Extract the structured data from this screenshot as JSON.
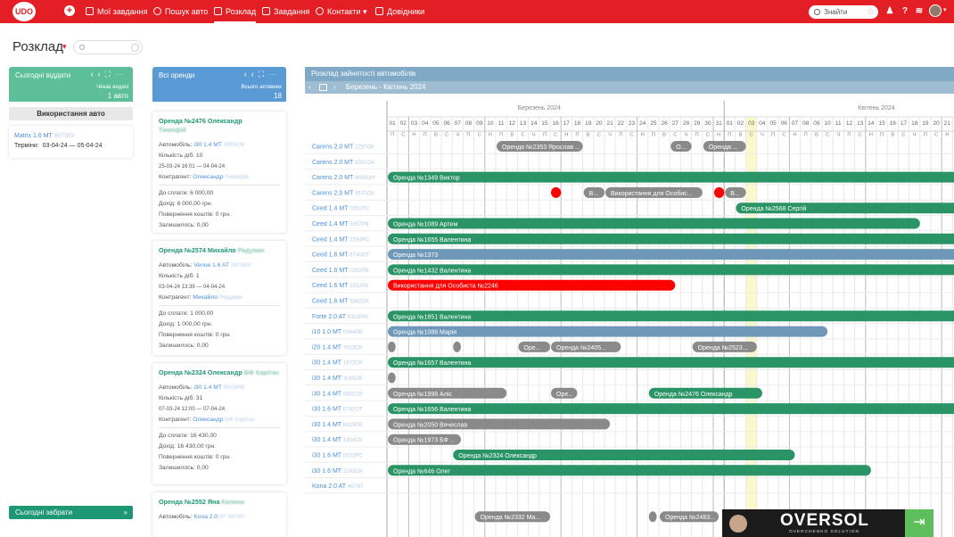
{
  "nav": {
    "logo_text": "UDO",
    "items": [
      "Мої завдання",
      "Пошук авто",
      "Розклад",
      "Завдання",
      "Контакти",
      "Довідники"
    ],
    "search_placeholder": "Знайти"
  },
  "page": {
    "title": "Розклад"
  },
  "today_give": {
    "title": "Сьогодні віддати",
    "subtitle": "Чекає видачі",
    "count": "1 авто"
  },
  "usage_button": "Використання авто",
  "usage_card": {
    "car": "Matrix 1.6 MT",
    "plate": "8079ОІ",
    "label": "Терміни:",
    "dates": "03-04-24 — 05-04-24"
  },
  "today_pick": {
    "title": "Сьогодні забрати"
  },
  "all_rentals": {
    "title": "Всі оренди",
    "subtitle": "Всього активних",
    "count": "18"
  },
  "rentals": [
    {
      "title": "Оренда №2476 Олександр",
      "surname": "Тимофій",
      "car": "i30 1.4 MT",
      "plate": "3065ОК",
      "days": "10",
      "period": "25-03-24 16:01 — 04-04-24",
      "counterparty": "Олександр",
      "counterparty_last": "Тимофій",
      "to_pay": "6 000,00",
      "income": "6 000,00 грн.",
      "refund": "0 грн.",
      "left": "0,00"
    },
    {
      "title": "Оренда №2574 Михайло",
      "surname": "Радуван",
      "car": "Venue 1.6 AT",
      "plate": "2678КК",
      "days": "1",
      "period": "03-04-24 13:39 — 04-04-24",
      "counterparty": "Михайло",
      "counterparty_last": "Радуван",
      "to_pay": "1 000,00",
      "income": "1 000,00 грн.",
      "refund": "0 грн.",
      "left": "0,00"
    },
    {
      "title": "Оренда №2324 Олександр",
      "surname": "БФ Карітас",
      "car": "i30 1.4 MT",
      "plate": "8919РВ",
      "days": "31",
      "period": "07-03-24 12:00 — 07-04-24",
      "counterparty": "Олександр",
      "counterparty_last": "БФ Карітас",
      "to_pay": "16 430,00",
      "income": "16 430,00 грн.",
      "refund": "0 грн.",
      "left": "0,00"
    },
    {
      "title": "Оренда №2552 Яна",
      "surname": "Калина",
      "car": "Kona 2.0",
      "plate": "07 4674П"
    }
  ],
  "rental_labels": {
    "car": "Автомобіль:",
    "days": "Кількість діб:",
    "counterparty": "Контрагент:",
    "to_pay": "До сплати:",
    "income": "Дохід:",
    "refund": "Повернення коштів:",
    "left": "Залишилось:"
  },
  "schedule": {
    "title": "Розклад зайнятості автомобілів",
    "range": "Березень - Квітень 2024",
    "months": [
      "Березень 2024",
      "Квітень 2024"
    ],
    "first_day": 1,
    "first_weekday_index": 4,
    "weekday_letters": [
      "П",
      "В",
      "С",
      "Ч",
      "П",
      "С",
      "Н"
    ],
    "today_day": 34,
    "cars": [
      {
        "name": "Carens 2.0 MT",
        "plate": "2257ОК"
      },
      {
        "name": "Carens 2.0 MT",
        "plate": "8331ОХ"
      },
      {
        "name": "Carens 2.0 MT",
        "plate": "9606ОН"
      },
      {
        "name": "Carens 2.0 MT",
        "plate": "9570ОХ"
      },
      {
        "name": "Ceed 1.4 MT",
        "plate": "0551РС"
      },
      {
        "name": "Ceed 1.4 MT",
        "plate": "5957РВ"
      },
      {
        "name": "Ceed 1.4 MT",
        "plate": "2334РС"
      },
      {
        "name": "Ceed 1.6 MT",
        "plate": "8740ОТ"
      },
      {
        "name": "Ceed 1.6 MT",
        "plate": "0282РВ"
      },
      {
        "name": "Ceed 1.6 MT",
        "plate": "1552РК"
      },
      {
        "name": "Ceed 1.6 MT",
        "plate": "5882ОХ"
      },
      {
        "name": "Forte 2.0 AT",
        "plate": "6363РМ"
      },
      {
        "name": "i10 1.0 MT",
        "plate": "0964РВ"
      },
      {
        "name": "i20 1.4 MT",
        "plate": "7623ОХ"
      },
      {
        "name": "i30 1.4 MT",
        "plate": "1672ОХ"
      },
      {
        "name": "i30 1.4 MT",
        "plate": "3065ОК"
      },
      {
        "name": "i30 1.4 MT",
        "plate": "5881ОХ"
      },
      {
        "name": "i30 1.6 MT",
        "plate": "8782ОТ"
      },
      {
        "name": "i30 1.4 MT",
        "plate": "8919РВ"
      },
      {
        "name": "i30 1.4 MT",
        "plate": "1904ОХ"
      },
      {
        "name": "i30 1.6 MT",
        "plate": "0552РС"
      },
      {
        "name": "i30 1.6 MT",
        "plate": "2243ОХ"
      },
      {
        "name": "Kona 2.0 AT",
        "plate": "4674П"
      }
    ],
    "bookings": [
      {
        "row": 0,
        "start": 11,
        "end": 19,
        "label": "Оренда №2353 Ярослав ...",
        "color": "#8a8a8a"
      },
      {
        "row": 0,
        "start": 27,
        "end": 29,
        "label": "О...",
        "color": "#8a8a8a"
      },
      {
        "row": 0,
        "start": 30,
        "end": 34,
        "label": "Оренда ...",
        "color": "#8a8a8a"
      },
      {
        "row": 2,
        "start": 1,
        "end": 54,
        "label": "Оренда №1349 Виктор",
        "color": "#2a9467"
      },
      {
        "row": 3,
        "start": 16,
        "end": 17,
        "label": "",
        "color": "#ff0000"
      },
      {
        "row": 3,
        "start": 19,
        "end": 21,
        "label": "В...",
        "color": "#8a8a8a"
      },
      {
        "row": 3,
        "start": 21,
        "end": 30,
        "label": "Використання для Особис...",
        "color": "#8a8a8a"
      },
      {
        "row": 3,
        "start": 31,
        "end": 32,
        "label": "",
        "color": "#ff0000"
      },
      {
        "row": 3,
        "start": 32,
        "end": 34,
        "label": "В...",
        "color": "#8a8a8a"
      },
      {
        "row": 4,
        "start": 33,
        "end": 54,
        "label": "Оренда №2568 Сергій",
        "color": "#2a9467"
      },
      {
        "row": 5,
        "start": 1,
        "end": 50,
        "label": "Оренда №1089 Артем",
        "color": "#2a9467"
      },
      {
        "row": 6,
        "start": 1,
        "end": 54,
        "label": "Оренда №1655 Валентина",
        "color": "#2a9467"
      },
      {
        "row": 7,
        "start": 1,
        "end": 54,
        "label": "Оренда №1373",
        "color": "#6f98b8"
      },
      {
        "row": 8,
        "start": 1,
        "end": 54,
        "label": "Оренда №1432 Валентина",
        "color": "#2a9467"
      },
      {
        "row": 9,
        "start": 1,
        "end": 27.5,
        "label": "Використання для Особиста №2246",
        "color": "#ff0000"
      },
      {
        "row": 11,
        "start": 1,
        "end": 54,
        "label": "Оренда №1851 Валентина",
        "color": "#2a9467"
      },
      {
        "row": 12,
        "start": 1,
        "end": 41.5,
        "label": "Оренда №1088 Марія",
        "color": "#6f98b8"
      },
      {
        "row": 13,
        "start": 1,
        "end": 1.8,
        "label": "",
        "color": "#8a8a8a"
      },
      {
        "row": 13,
        "start": 7,
        "end": 7.8,
        "label": "",
        "color": "#8a8a8a"
      },
      {
        "row": 13,
        "start": 13,
        "end": 16,
        "label": "Оре...",
        "color": "#8a8a8a"
      },
      {
        "row": 13,
        "start": 16,
        "end": 22.5,
        "label": "Оренда №2405...",
        "color": "#8a8a8a"
      },
      {
        "row": 13,
        "start": 29,
        "end": 35,
        "label": "Оренда №2523...",
        "color": "#8a8a8a"
      },
      {
        "row": 14,
        "start": 1,
        "end": 54,
        "label": "Оренда №1657 Валентина",
        "color": "#2a9467"
      },
      {
        "row": 15,
        "start": 1,
        "end": 1.8,
        "label": "",
        "color": "#8a8a8a"
      },
      {
        "row": 16,
        "start": 1,
        "end": 12,
        "label": "Оренда №1998 Аліс",
        "color": "#8a8a8a"
      },
      {
        "row": 16,
        "start": 16,
        "end": 18.5,
        "label": "Оре...",
        "color": "#8a8a8a"
      },
      {
        "row": 16,
        "start": 25,
        "end": 35.5,
        "label": "Оренда №2476 Олександр",
        "color": "#2a9467"
      },
      {
        "row": 17,
        "start": 1,
        "end": 54,
        "label": "Оренда №1656 Валентина",
        "color": "#2a9467"
      },
      {
        "row": 18,
        "start": 1,
        "end": 21.5,
        "label": "Оренда №2050 Вячеслав",
        "color": "#8a8a8a"
      },
      {
        "row": 19,
        "start": 1,
        "end": 7.8,
        "label": "Оренда №1973 БФ ...",
        "color": "#8a8a8a"
      },
      {
        "row": 20,
        "start": 7,
        "end": 38.5,
        "label": "Оренда №2324 Олександр",
        "color": "#2a9467"
      },
      {
        "row": 21,
        "start": 1,
        "end": 45.5,
        "label": "Оренда №646 Олег",
        "color": "#2a9467"
      },
      {
        "row": 24,
        "start": 9,
        "end": 16,
        "label": "Оренда №2332 Ма...",
        "color": "#8a8a8a"
      },
      {
        "row": 24,
        "start": 25,
        "end": 25.8,
        "label": "",
        "color": "#8a8a8a"
      },
      {
        "row": 24,
        "start": 26,
        "end": 31.5,
        "label": "Оренда №2483...",
        "color": "#8a8a8a"
      }
    ]
  },
  "credit": {
    "brand": "OVERSOL",
    "tagline": "OVERCHENKO SOLUTION"
  },
  "colors": {
    "brand_red": "#e31e24",
    "teal": "#5cbf9a",
    "green": "#2a9467",
    "blue": "#5b9bd5"
  }
}
